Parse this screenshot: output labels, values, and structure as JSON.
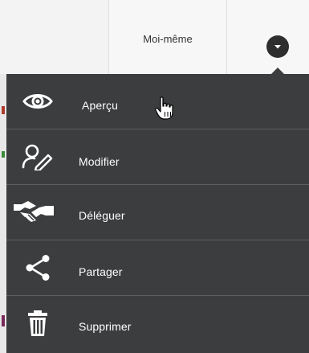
{
  "owner_cell": {
    "label": "Moi-même"
  },
  "toggle": {
    "icon": "chevron-down-icon"
  },
  "menu": {
    "items": [
      {
        "label": "Aperçu",
        "icon": "eye-icon"
      },
      {
        "label": "Modifier",
        "icon": "edit-user-icon"
      },
      {
        "label": "Déléguer",
        "icon": "handshake-icon"
      },
      {
        "label": "Partager",
        "icon": "share-icon"
      },
      {
        "label": "Supprimer",
        "icon": "trash-icon"
      }
    ]
  },
  "colors": {
    "menu_bg": "#3b3d3f",
    "menu_text": "#ffffff",
    "separator": "#5c5e60",
    "toggle_bg": "#2e2e2e"
  }
}
